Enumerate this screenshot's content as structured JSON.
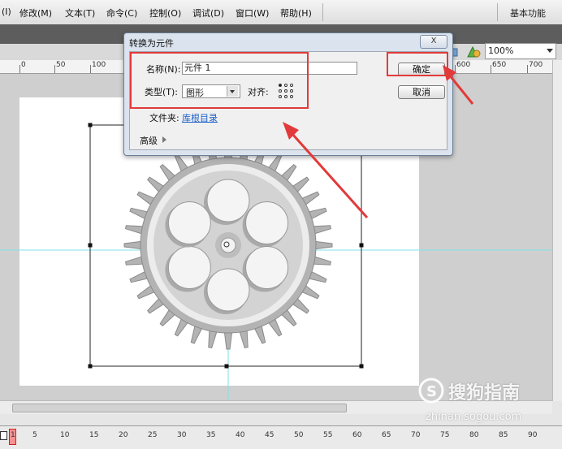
{
  "menubar": {
    "items": [
      "(I)",
      "修改(M)",
      "文本(T)",
      "命令(C)",
      "控制(O)",
      "调试(D)",
      "窗口(W)",
      "帮助(H)"
    ],
    "workspace": "基本功能"
  },
  "toolbar": {
    "zoom": "100%"
  },
  "ruler": {
    "top_labels": [
      "0",
      "50",
      "100",
      "600",
      "650",
      "700"
    ]
  },
  "timeline": {
    "frame_labels": [
      "1",
      "5",
      "10",
      "15",
      "20",
      "25",
      "30",
      "35",
      "40",
      "45",
      "50",
      "55",
      "60",
      "65",
      "70",
      "75",
      "80",
      "85",
      "90"
    ]
  },
  "dialog": {
    "title": "转换为元件",
    "close_label": "X",
    "name_label": "名称(N):",
    "name_value": "元件 1",
    "type_label": "类型(T):",
    "type_value": "图形",
    "align_label": "对齐:",
    "folder_label": "文件夹:",
    "folder_link": "库根目录",
    "advanced_label": "高级",
    "ok_label": "确定",
    "cancel_label": "取消"
  },
  "watermark": {
    "main": "搜狗指南",
    "sub": "zhinan.sogou.com"
  },
  "colors": {
    "annotation_red": "#e23a3a",
    "guide_cyan": "#7fe3ea",
    "gear_gray": "#a9a9a9",
    "link_blue": "#1b5fc7"
  }
}
